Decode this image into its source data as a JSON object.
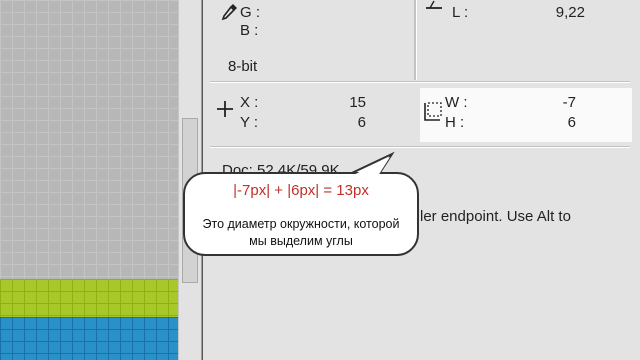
{
  "info_panel": {
    "g_label": "G :",
    "b_label": "B :",
    "bit_depth": "8-bit",
    "l_label": "L :",
    "l_value": "9,22",
    "x_label": "X :",
    "x_value": "15",
    "y_label": "Y :",
    "y_value": "6",
    "w_label": "W :",
    "w_value": "-7",
    "h_label": "H :",
    "h_value": "6",
    "doc_size": "Doc: 52,4K/59,9K",
    "hint_text": "ler endpoint. Use Alt to"
  },
  "callout": {
    "formula": "|-7px| + |6px| = 13px",
    "text_line1": "Это диаметр окружности, которой",
    "text_line2": "мы выделим углы"
  },
  "colors": {
    "formula": "#c0312a",
    "canvas_green": "#a8c82a",
    "canvas_blue": "#2a90c8"
  }
}
